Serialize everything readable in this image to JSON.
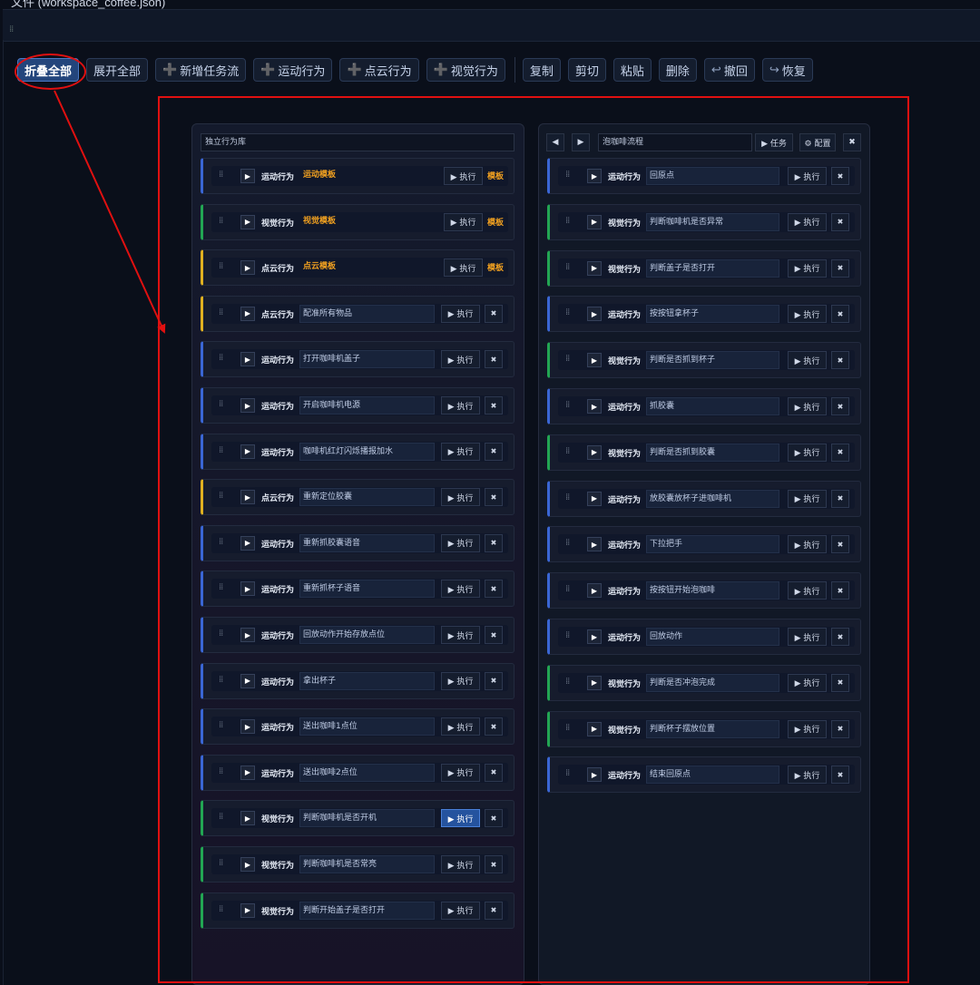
{
  "window": {
    "file_title": "文件 (workspace_coffee.json)"
  },
  "toolbar": {
    "collapse_all": "折叠全部",
    "expand_all": "展开全部",
    "new_flow": "新增任务流",
    "motion": "运动行为",
    "pointcloud": "点云行为",
    "vision": "视觉行为",
    "copy": "复制",
    "cut": "剪切",
    "paste": "粘贴",
    "delete": "删除",
    "undo": "撤回",
    "redo": "恢复"
  },
  "labels": {
    "exec": "▶ 执行",
    "close": "✖",
    "template_badge": "模板"
  },
  "library": {
    "title": "独立行为库",
    "cards": [
      {
        "type": "运动行为",
        "name": "运动模板",
        "color": "blue",
        "template": true
      },
      {
        "type": "视觉行为",
        "name": "视觉模板",
        "color": "green",
        "template": true
      },
      {
        "type": "点云行为",
        "name": "点云模板",
        "color": "yellow",
        "template": true
      },
      {
        "type": "点云行为",
        "name": "配准所有物品",
        "color": "yellow"
      },
      {
        "type": "运动行为",
        "name": "打开咖啡机盖子",
        "color": "blue"
      },
      {
        "type": "运动行为",
        "name": "开启咖啡机电源",
        "color": "blue"
      },
      {
        "type": "运动行为",
        "name": "咖啡机红灯闪烁播报加水",
        "color": "blue"
      },
      {
        "type": "点云行为",
        "name": "重新定位胶囊",
        "color": "yellow"
      },
      {
        "type": "运动行为",
        "name": "重新抓胶囊语音",
        "color": "blue"
      },
      {
        "type": "运动行为",
        "name": "重新抓杯子语音",
        "color": "blue"
      },
      {
        "type": "运动行为",
        "name": "回放动作开始存放点位",
        "color": "blue"
      },
      {
        "type": "运动行为",
        "name": "拿出杯子",
        "color": "blue"
      },
      {
        "type": "运动行为",
        "name": "送出咖啡1点位",
        "color": "blue"
      },
      {
        "type": "运动行为",
        "name": "送出咖啡2点位",
        "color": "blue"
      },
      {
        "type": "视觉行为",
        "name": "判断咖啡机是否开机",
        "color": "green",
        "active": true
      },
      {
        "type": "视觉行为",
        "name": "判断咖啡机是否常亮",
        "color": "green"
      },
      {
        "type": "视觉行为",
        "name": "判断开始盖子是否打开",
        "color": "green"
      }
    ]
  },
  "flow": {
    "name": "泡咖啡流程",
    "task_label": "▶ 任务",
    "config_label": "⚙ 配置",
    "cards": [
      {
        "type": "运动行为",
        "name": "回原点",
        "color": "blue"
      },
      {
        "type": "视觉行为",
        "name": "判断咖啡机是否异常",
        "color": "green"
      },
      {
        "type": "视觉行为",
        "name": "判断盖子是否打开",
        "color": "green"
      },
      {
        "type": "运动行为",
        "name": "按按钮拿杯子",
        "color": "blue"
      },
      {
        "type": "视觉行为",
        "name": "判断是否抓到杯子",
        "color": "green"
      },
      {
        "type": "运动行为",
        "name": "抓胶囊",
        "color": "blue"
      },
      {
        "type": "视觉行为",
        "name": "判断是否抓到胶囊",
        "color": "green"
      },
      {
        "type": "运动行为",
        "name": "放胶囊放杯子进咖啡机",
        "color": "blue"
      },
      {
        "type": "运动行为",
        "name": "下拉把手",
        "color": "blue"
      },
      {
        "type": "运动行为",
        "name": "按按钮开始泡咖啡",
        "color": "blue"
      },
      {
        "type": "运动行为",
        "name": "回放动作",
        "color": "blue"
      },
      {
        "type": "视觉行为",
        "name": "判断是否冲泡完成",
        "color": "green"
      },
      {
        "type": "视觉行为",
        "name": "判断杯子摆放位置",
        "color": "green"
      },
      {
        "type": "运动行为",
        "name": "结束回原点",
        "color": "blue"
      }
    ]
  },
  "annotation": {
    "color": "#e01010"
  }
}
